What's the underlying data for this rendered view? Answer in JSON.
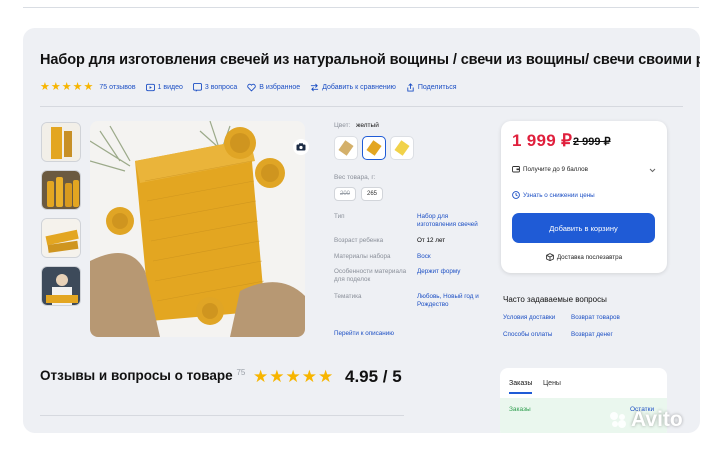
{
  "product": {
    "title": "Набор для изготовления свечей из натуральной вощины / свечи из вощины/ свечи своими руками"
  },
  "meta": {
    "reviews_count": "75 отзывов",
    "video": "1 видео",
    "questions": "3 вопроса",
    "favorites": "В избранное",
    "compare": "Добавить к сравнению",
    "share": "Поделиться"
  },
  "options": {
    "color_label": "Цвет:",
    "color_value": "желтый",
    "weight_label": "Вес товара, г:",
    "weights": [
      "200",
      "265"
    ]
  },
  "specs": [
    {
      "label": "Тип",
      "value": "Набор для изготовления свечей",
      "link": true
    },
    {
      "label": "Возраст ребенка",
      "value": "От 12 лет",
      "link": false
    },
    {
      "label": "Материалы набора",
      "value": "Воск",
      "link": true
    },
    {
      "label": "Особенности материала для поделок",
      "value": "Держит форму",
      "link": true
    },
    {
      "label": "Тематика",
      "value": "Любовь, Новый год и Рождество",
      "link": true
    }
  ],
  "specs_link": "Перейти к описанию",
  "buy": {
    "price": "1 999 ₽",
    "old_price": "2 999 ₽",
    "points": "Получите до 9 баллов",
    "price_drop": "Узнать о снижении цены",
    "cart_button": "Добавить в корзину",
    "delivery": "Доставка послезавтра"
  },
  "faq": {
    "title": "Часто задаваемые вопросы",
    "items": [
      "Условия доставки",
      "Возврат товаров",
      "Способы оплаты",
      "Возврат денег"
    ]
  },
  "reviews_section": {
    "title": "Отзывы и вопросы о товаре",
    "count": "75",
    "score": "4.95 / 5",
    "rating": 4.95
  },
  "orders_tabs": {
    "tab1": "Заказы",
    "tab2": "Цены",
    "row_label": "Заказы",
    "row_value": "Остатки"
  },
  "watermark": "Avito",
  "colors": {
    "accent": "#1f5bd6",
    "price": "#e0203d",
    "star": "#f7b500",
    "wax": "#e3a621"
  }
}
